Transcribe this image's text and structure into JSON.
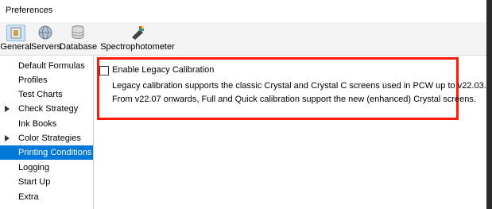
{
  "window": {
    "title": "Preferences"
  },
  "toolbar": {
    "items": [
      {
        "label": "General",
        "icon": "general-icon",
        "active": true
      },
      {
        "label": "Servers",
        "icon": "globe-icon"
      },
      {
        "label": "Database",
        "icon": "database-icon"
      },
      {
        "label": "Spectrophotometer",
        "icon": "spectrophotometer-icon"
      }
    ]
  },
  "sidebar": {
    "items": [
      {
        "label": "Default Formulas"
      },
      {
        "label": "Profiles"
      },
      {
        "label": "Test Charts"
      },
      {
        "label": "Check Strategy",
        "expandable": true
      },
      {
        "label": "Ink Books"
      },
      {
        "label": "Color Strategies",
        "expandable": true
      },
      {
        "label": "Printing Conditions",
        "selected": true
      },
      {
        "label": "Logging"
      },
      {
        "label": "Start Up"
      },
      {
        "label": "Extra"
      }
    ]
  },
  "main": {
    "checkbox_label": "Enable Legacy Calibration",
    "checkbox_checked": false,
    "description_line1": "Legacy calibration supports the classic Crystal and Crystal C screens used in PCW up to v22.03.",
    "description_line2": "From v22.07 onwards, Full and Quick calibration support the new (enhanced) Crystal screens."
  },
  "colors": {
    "selection": "#0078d7",
    "highlight_border": "#ff1a0a"
  }
}
